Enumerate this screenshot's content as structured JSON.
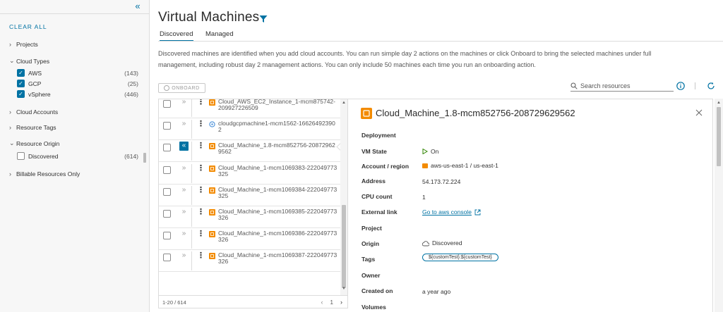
{
  "filters": {
    "collapse_glyph": "«",
    "clear_all": "CLEAR ALL",
    "projects": "Projects",
    "cloud_types": {
      "label": "Cloud Types",
      "items": [
        {
          "label": "AWS",
          "count": "(143)",
          "checked": true
        },
        {
          "label": "GCP",
          "count": "(25)",
          "checked": true
        },
        {
          "label": "vSphere",
          "count": "(446)",
          "checked": true
        }
      ]
    },
    "cloud_accounts": "Cloud Accounts",
    "resource_tags": "Resource Tags",
    "resource_origin": {
      "label": "Resource Origin",
      "items": [
        {
          "label": "Discovered",
          "count": "(614)",
          "checked": false
        }
      ]
    },
    "billable": "Billable Resources Only"
  },
  "header": {
    "title": "Virtual Machines",
    "tabs": [
      {
        "label": "Discovered",
        "active": true
      },
      {
        "label": "Managed",
        "active": false
      }
    ],
    "description": "Discovered machines are identified when you add cloud accounts. You can run simple day 2 actions on the machines or click Onboard to bring the selected machines under full management, including robust day 2 management actions. You can only include 50 machines each time you run an onboarding action."
  },
  "toolbar": {
    "onboard_label": "ONBOARD",
    "search_placeholder": "Search resources"
  },
  "list": {
    "rows": [
      {
        "name": "Cloud_AWS_EC2_Instance_1-mcm875742-209927226509",
        "type": "aws",
        "selected": false
      },
      {
        "name": "cloudgcpmachine1-mcm1562-166264923902",
        "type": "gcp",
        "selected": false
      },
      {
        "name": "Cloud_Machine_1.8-mcm852756-208729629562",
        "type": "aws",
        "selected": true
      },
      {
        "name": "Cloud_Machine_1-mcm1069383-222049773325",
        "type": "aws",
        "selected": false
      },
      {
        "name": "Cloud_Machine_1-mcm1069384-222049773325",
        "type": "aws",
        "selected": false
      },
      {
        "name": "Cloud_Machine_1-mcm1069385-222049773326",
        "type": "aws",
        "selected": false
      },
      {
        "name": "Cloud_Machine_1-mcm1069386-222049773326",
        "type": "aws",
        "selected": false
      },
      {
        "name": "Cloud_Machine_1-mcm1069387-222049773326",
        "type": "aws",
        "selected": false
      }
    ],
    "range": "1-20 / 614",
    "page": "1",
    "prev_glyph": "‹",
    "next_glyph": "›"
  },
  "detail": {
    "title": "Cloud_Machine_1.8-mcm852756-208729629562",
    "fields": [
      {
        "label": "Deployment",
        "value": ""
      },
      {
        "label": "VM State",
        "value": "On"
      },
      {
        "label": "Account / region",
        "value": "aws-us-east-1 / us-east-1"
      },
      {
        "label": "Address",
        "value": "54.173.72.224"
      },
      {
        "label": "CPU count",
        "value": "1"
      },
      {
        "label": "External link",
        "value": "Go to aws console"
      },
      {
        "label": "Project",
        "value": ""
      },
      {
        "label": "Origin",
        "value": "Discovered"
      },
      {
        "label": "Tags",
        "value": "${customTest}:${customTest}"
      },
      {
        "label": "Owner",
        "value": ""
      },
      {
        "label": "Created on",
        "value": "a year ago"
      },
      {
        "label": "Volumes",
        "value": ""
      }
    ]
  },
  "colors": {
    "accent": "#0072a3",
    "aws_orange": "#f38b00",
    "gcp_blue": "#4a90d9"
  }
}
